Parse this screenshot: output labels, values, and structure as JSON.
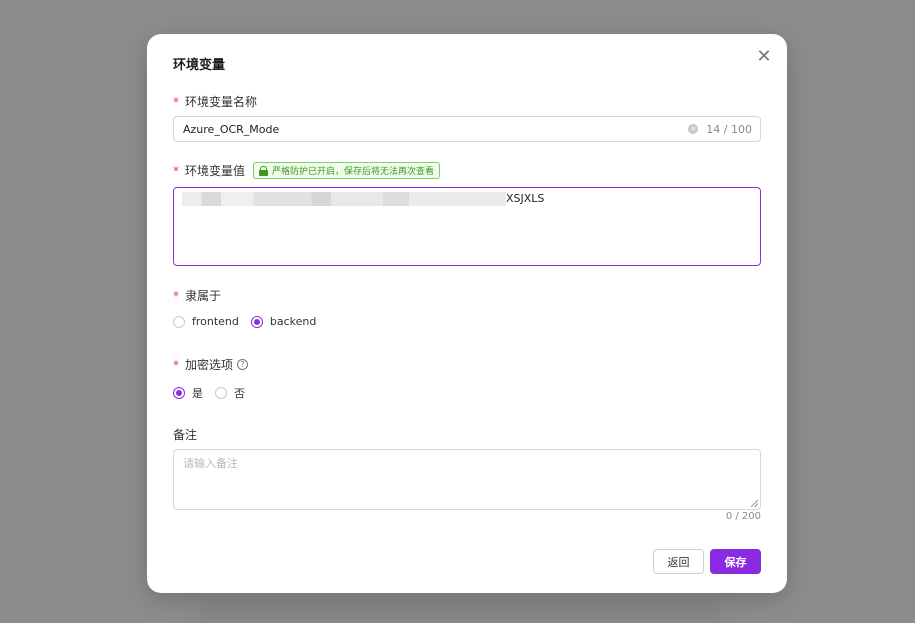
{
  "dialog": {
    "title": "环境变量",
    "close_icon": "close-icon"
  },
  "fields": {
    "name": {
      "label": "环境变量名称",
      "value": "Azure_OCR_Mode",
      "counter": "14 / 100"
    },
    "value": {
      "label": "环境变量值",
      "badge": "严格防护已开启，保存后将无法再次查看",
      "value_suffix": "XSJXLS"
    },
    "belongs_to": {
      "label": "隶属于",
      "options": [
        "frontend",
        "backend"
      ],
      "selected": "backend"
    },
    "encryption": {
      "label": "加密选项",
      "options": [
        "是",
        "否"
      ],
      "selected": "是"
    },
    "remark": {
      "label": "备注",
      "placeholder": "请输入备注",
      "counter": "0 / 200"
    }
  },
  "buttons": {
    "back": "返回",
    "save": "保存"
  },
  "colors": {
    "accent": "#8a2be2",
    "required": "#e0453a",
    "badge_green": "#3c9a22"
  }
}
